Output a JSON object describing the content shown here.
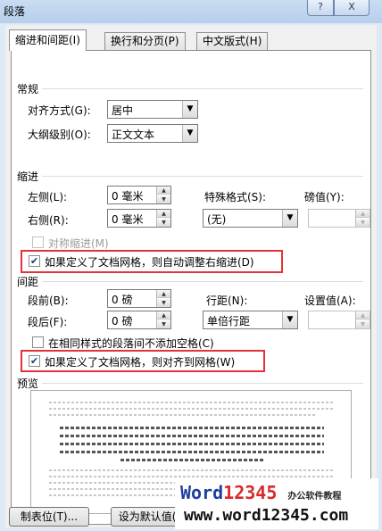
{
  "window": {
    "title": "段落",
    "help_glyph": "?",
    "close_glyph": "X"
  },
  "tabs": [
    {
      "label": "缩进和间距(I)",
      "active": true
    },
    {
      "label": "换行和分页(P)",
      "active": false
    },
    {
      "label": "中文版式(H)",
      "active": false
    }
  ],
  "general": {
    "heading": "常规",
    "alignment_label": "对齐方式(G):",
    "alignment_value": "居中",
    "outline_label": "大纲级别(O):",
    "outline_value": "正文文本"
  },
  "indent": {
    "heading": "缩进",
    "left_label": "左侧(L):",
    "left_value": "0 毫米",
    "right_label": "右侧(R):",
    "right_value": "0 毫米",
    "special_label": "特殊格式(S):",
    "special_value": "(无)",
    "by_label": "磅值(Y):",
    "by_value": "",
    "mirror_label": "对称缩进(M)",
    "mirror_checked": false,
    "auto_adjust_label": "如果定义了文档网格，则自动调整右缩进(D)",
    "auto_adjust_checked": true
  },
  "spacing": {
    "heading": "间距",
    "before_label": "段前(B):",
    "before_value": "0 磅",
    "after_label": "段后(F):",
    "after_value": "0 磅",
    "line_label": "行距(N):",
    "line_value": "单倍行距",
    "at_label": "设置值(A):",
    "at_value": "",
    "no_space_label": "在相同样式的段落间不添加空格(C)",
    "no_space_checked": false,
    "snap_grid_label": "如果定义了文档网格，则对齐到网格(W)",
    "snap_grid_checked": true
  },
  "preview": {
    "heading": "预览"
  },
  "buttons": {
    "tabs_button": "制表位(T)...",
    "default_button": "设为默认值(D)"
  },
  "watermark": {
    "word": "Word",
    "digits": "12345",
    "tag": "办公软件教程",
    "url": "www.word12345.com"
  },
  "colors": {
    "highlight_box": "#e0343a",
    "title_bar": "#c9dcf2"
  }
}
